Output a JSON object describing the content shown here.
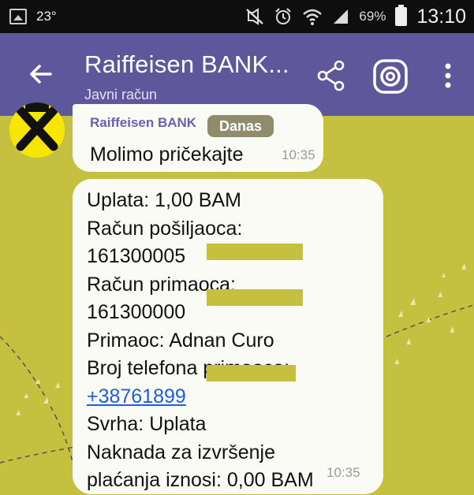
{
  "status_bar": {
    "temperature": "23°",
    "battery_percent": "69%",
    "time": "13:10"
  },
  "app_bar": {
    "title": "Raiffeisen BANK...",
    "subtitle": "Javni račun"
  },
  "date_divider": "Danas",
  "messages": [
    {
      "sender": "Raiffeisen BANK",
      "text": "Molimo pričekajte",
      "time": "10:35"
    },
    {
      "lines": [
        "Uplata: 1,00 BAM",
        "Račun pošiljaoca:",
        "161300005",
        "Račun primaoca:",
        "161300000",
        "Primaoc: Adnan Curo",
        "Broj telefona primaoca:",
        "+38761899",
        "Svrha: Uplata",
        "Naknada za izvršenje",
        "plaćanja iznosi: 0,00 BAM"
      ],
      "time": "10:35"
    }
  ],
  "colors": {
    "app_bar": "#5e579b",
    "chat_background": "#c6c040",
    "bubble": "#fbfbf6",
    "link": "#1e5be6",
    "sender_name": "#6b5fb0"
  },
  "icons": {
    "status_left": [
      "gallery-icon"
    ],
    "status_right": [
      "mute-icon",
      "alarm-icon",
      "wifi-icon",
      "signal-icon",
      "battery-icon"
    ],
    "app_bar": [
      "back-arrow-icon",
      "share-icon",
      "viber-icon",
      "overflow-menu-icon"
    ]
  }
}
